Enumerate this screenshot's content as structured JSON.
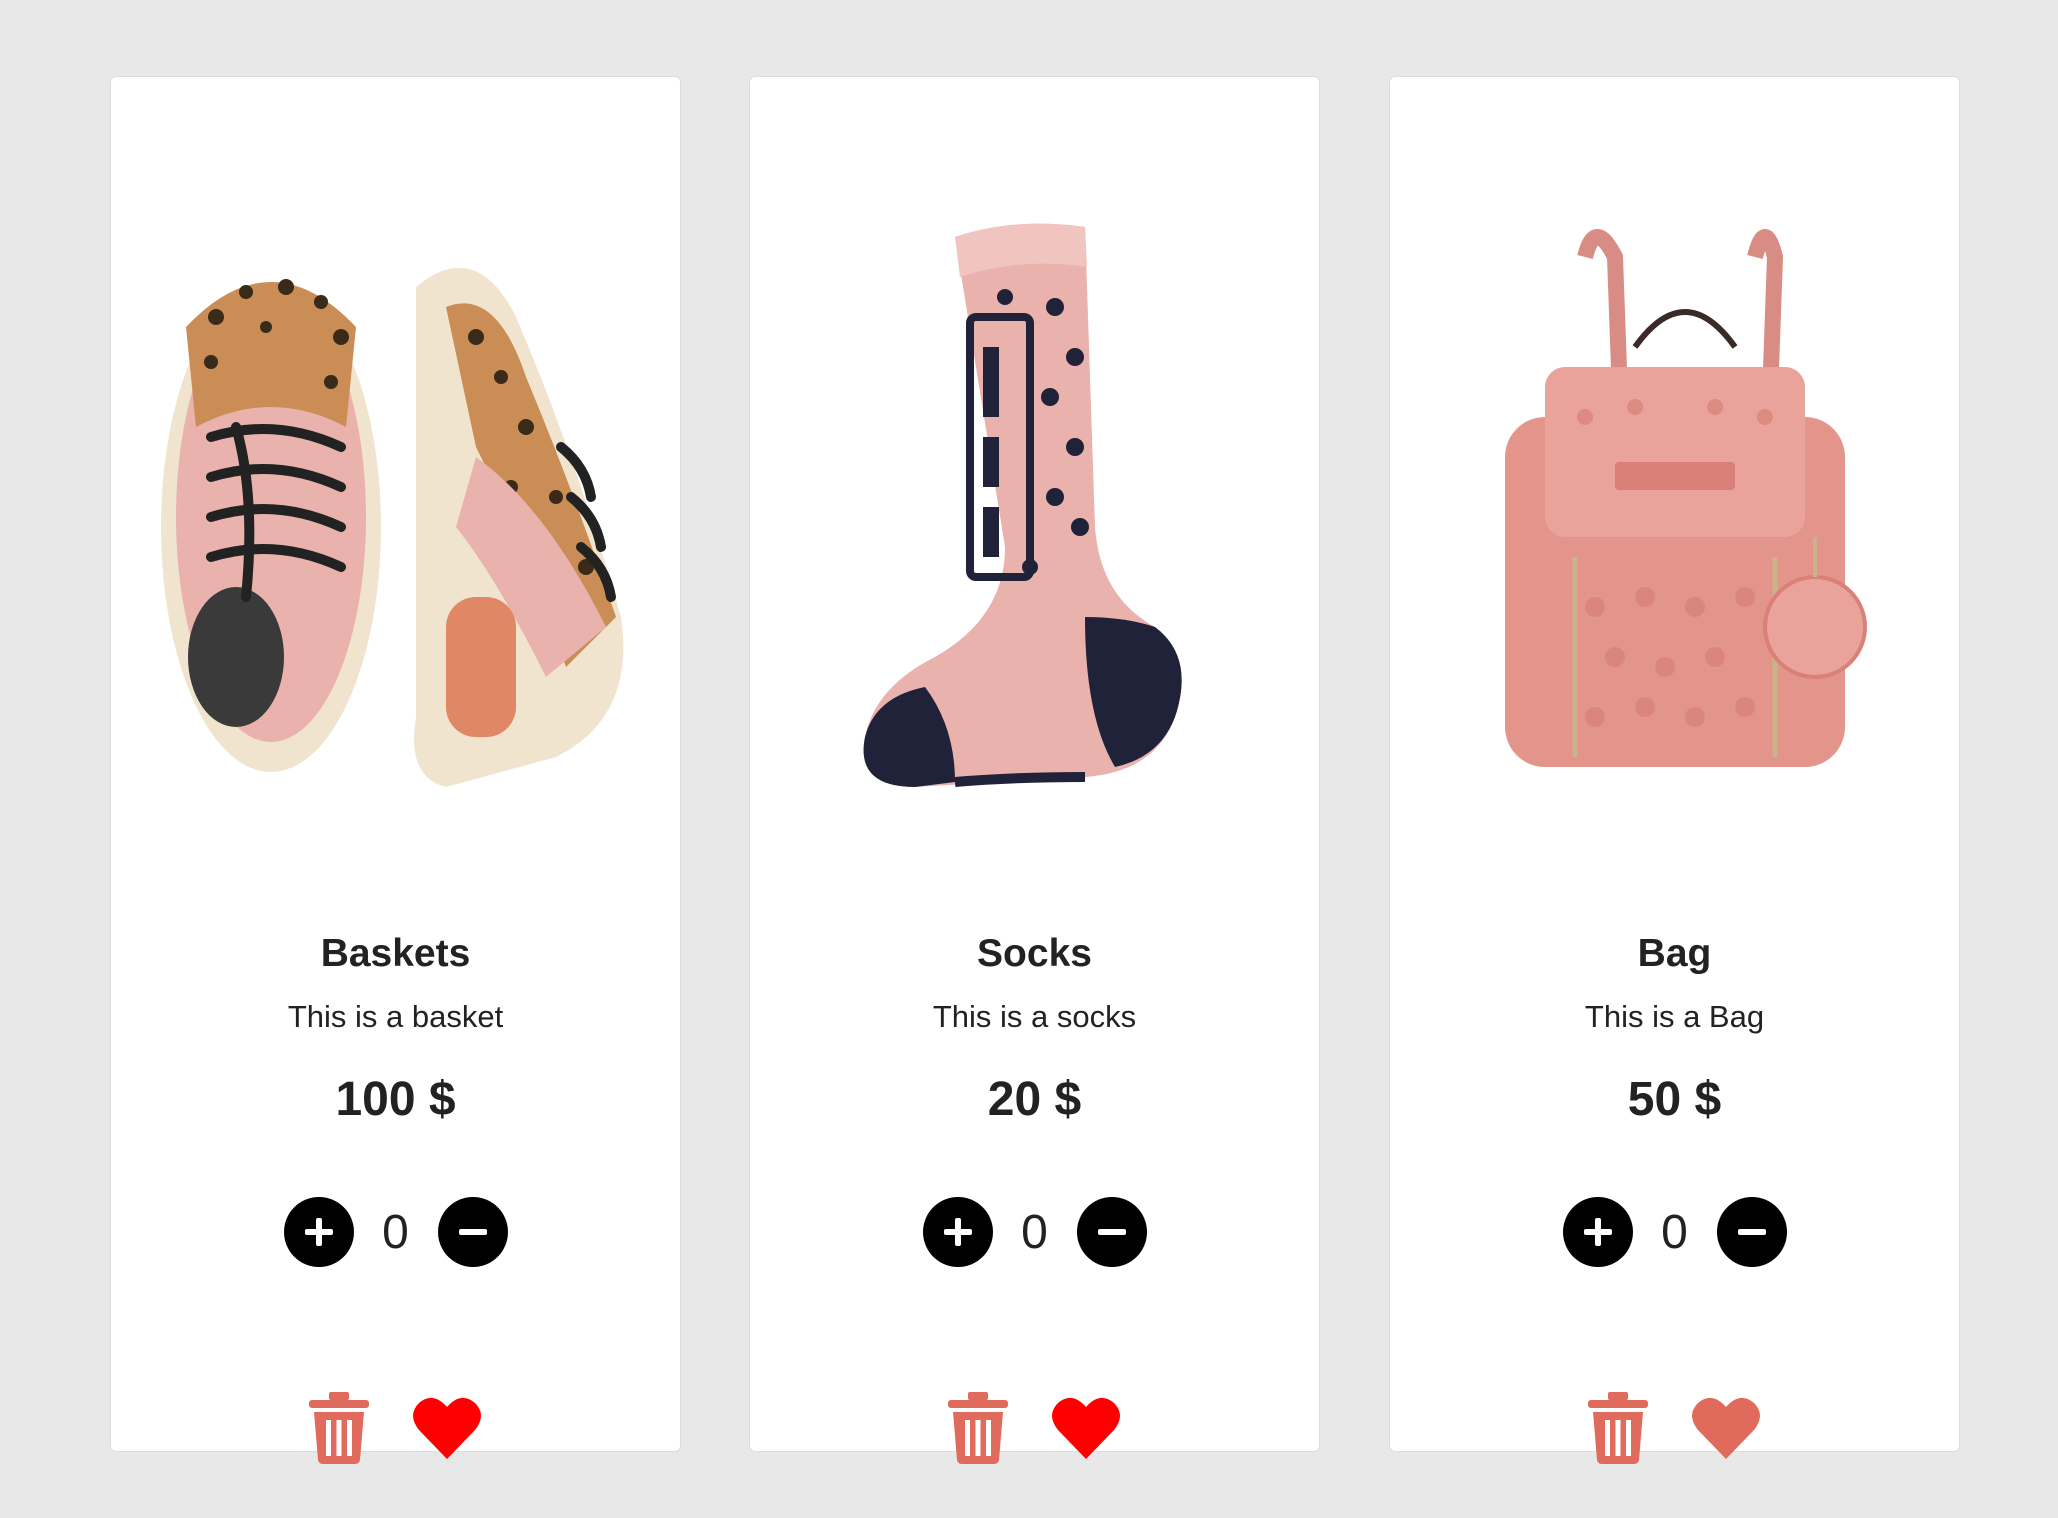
{
  "colors": {
    "page_background": "#e8e8e8",
    "card_background": "#ffffff",
    "button_black": "#000000",
    "trash_color": "#e06b5c",
    "heart_liked": "#ff0000",
    "heart_unliked": "#e06b5c"
  },
  "products": [
    {
      "name": "Baskets",
      "description": "This is a basket",
      "price": "100 $",
      "quantity": "0",
      "liked": true,
      "image_icon": "sneakers-image"
    },
    {
      "name": "Socks",
      "description": "This is a socks",
      "price": "20 $",
      "quantity": "0",
      "liked": true,
      "image_icon": "sock-image"
    },
    {
      "name": "Bag",
      "description": "This is a Bag",
      "price": "50 $",
      "quantity": "0",
      "liked": false,
      "image_icon": "backpack-image"
    }
  ]
}
